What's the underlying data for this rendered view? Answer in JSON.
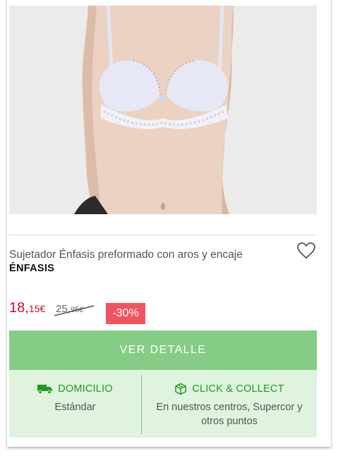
{
  "product": {
    "title": "Sujetador Énfasis preformado con aros y encaje",
    "brand": "ÉNFASIS",
    "image_alt": "Sujetador blanco con encaje"
  },
  "price": {
    "current_int": "18,",
    "current_dec": "15€",
    "old_int": "25,",
    "old_dec": "95€",
    "discount": "-30%"
  },
  "actions": {
    "detail_label": "VER DETALLE"
  },
  "delivery": {
    "home": {
      "title": "DOMICILIO",
      "desc": "Estándar",
      "icon": "truck-icon"
    },
    "click_collect": {
      "title": "CLICK & COLLECT",
      "desc": "En nuestros centros, Supercor y otros puntos",
      "icon": "box-icon"
    }
  },
  "colors": {
    "price": "#c8102e",
    "discount_bg": "#ef5560",
    "cta_bg": "#85cd87",
    "delivery_bg": "#dff3df",
    "delivery_accent": "#1e9a1e"
  }
}
